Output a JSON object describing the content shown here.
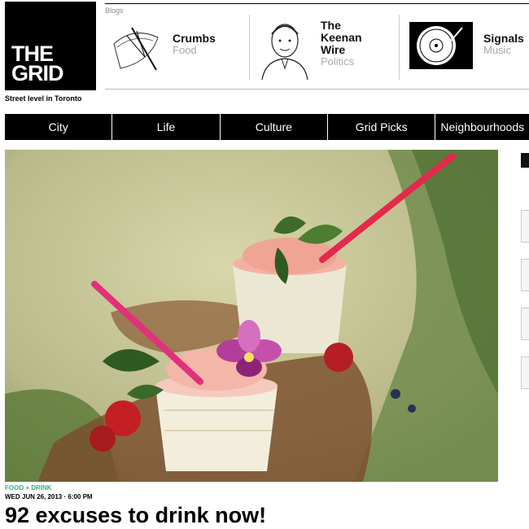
{
  "logo": {
    "text": "THE\nGRID"
  },
  "tagline": "Street level in Toronto",
  "blogs": {
    "label": "Blogs",
    "items": [
      {
        "title": "Crumbs",
        "category": "Food"
      },
      {
        "title": "The\nKeenan\nWire",
        "category": "Politics"
      },
      {
        "title": "Signals",
        "category": "Music"
      }
    ]
  },
  "nav": {
    "items": [
      "City",
      "Life",
      "Culture",
      "Grid Picks",
      "Neighbourhoods"
    ]
  },
  "article": {
    "kicker": "FOOD + DRINK",
    "date": "WED JUN 26, 2013 · 6:00 PM",
    "headline": "92 excuses to drink now!"
  },
  "colors": {
    "accent": "#35b37e",
    "nav_bg": "#000000"
  }
}
